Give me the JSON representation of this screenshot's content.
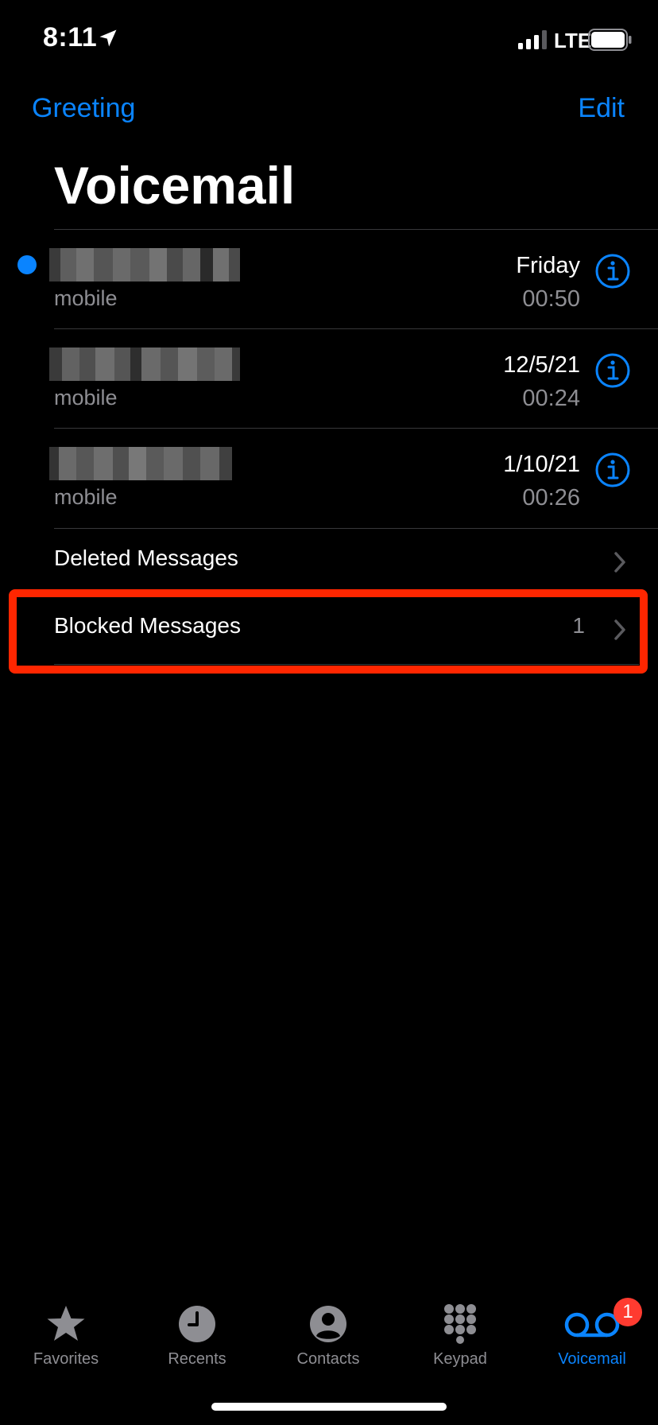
{
  "status_bar": {
    "time": "8:11",
    "network": "LTE"
  },
  "nav": {
    "left_label": "Greeting",
    "right_label": "Edit"
  },
  "title": "Voicemail",
  "voicemails": [
    {
      "label": "mobile",
      "date": "Friday",
      "duration": "00:50",
      "unread": true
    },
    {
      "label": "mobile",
      "date": "12/5/21",
      "duration": "00:24",
      "unread": false
    },
    {
      "label": "mobile",
      "date": "1/10/21",
      "duration": "00:26",
      "unread": false
    }
  ],
  "menu": {
    "deleted": {
      "label": "Deleted Messages"
    },
    "blocked": {
      "label": "Blocked Messages",
      "count": "1"
    }
  },
  "tabs": [
    {
      "label": "Favorites",
      "icon": "star-icon"
    },
    {
      "label": "Recents",
      "icon": "clock-icon"
    },
    {
      "label": "Contacts",
      "icon": "person-circle-icon"
    },
    {
      "label": "Keypad",
      "icon": "keypad-icon"
    },
    {
      "label": "Voicemail",
      "icon": "voicemail-icon",
      "active": true,
      "badge": "1"
    }
  ],
  "colors": {
    "accent": "#0a84ff",
    "highlight": "#ff2600",
    "badge": "#ff3b30",
    "secondary_text": "#8e8e93",
    "background": "#000000"
  }
}
